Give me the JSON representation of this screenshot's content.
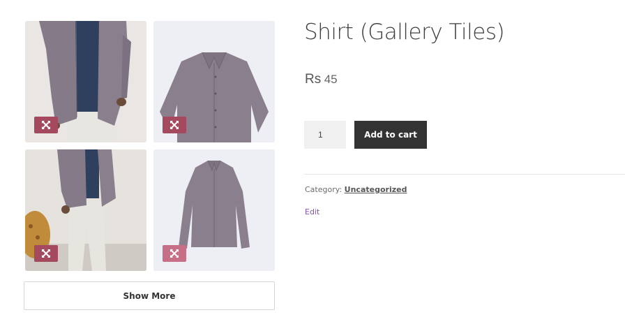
{
  "gallery": {
    "images": [
      {
        "name": "model-front-shirt",
        "zoom_icon": "expand-icon"
      },
      {
        "name": "shirt-flat",
        "zoom_icon": "expand-icon"
      },
      {
        "name": "model-side-shirt",
        "zoom_icon": "expand-icon"
      },
      {
        "name": "shirt-hanging",
        "zoom_icon": "expand-icon"
      }
    ],
    "show_more_label": "Show More"
  },
  "product": {
    "title": "Shirt (Gallery Tiles)",
    "price_currency": "Rs",
    "price_amount": "45",
    "quantity": "1",
    "add_to_cart_label": "Add to cart",
    "category_label": "Category:",
    "category_value": "Uncategorized",
    "edit_label": "Edit"
  },
  "colors": {
    "shirt": "#8a7f8c",
    "zoom_badge": "#a54a5e",
    "button_dark": "#333333",
    "edit_link": "#7f54b3"
  }
}
